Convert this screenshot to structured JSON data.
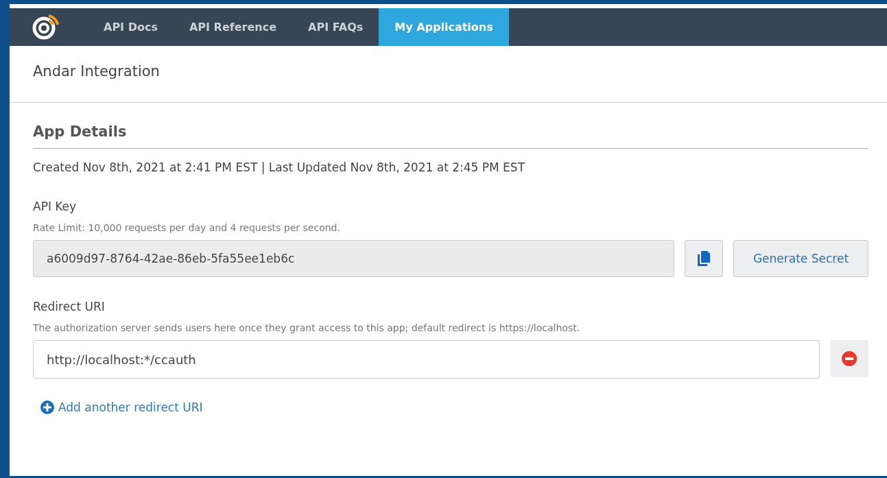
{
  "nav": {
    "tabs": [
      {
        "label": "API Docs",
        "selected": false
      },
      {
        "label": "API Reference",
        "selected": false
      },
      {
        "label": "API FAQs",
        "selected": false
      },
      {
        "label": "My Applications",
        "selected": true
      }
    ]
  },
  "page_title": "Andar Integration",
  "section": {
    "heading": "App Details",
    "timestamps": "Created Nov 8th, 2021 at 2:41 PM EST | Last Updated Nov 8th, 2021 at 2:45 PM EST",
    "api_key": {
      "label": "API Key",
      "hint": "Rate Limit: 10,000 requests per day and 4 requests per second.",
      "value": "a6009d97-8764-42ae-86eb-5fa55ee1eb6c",
      "button": "Generate Secret"
    },
    "redirect": {
      "label": "Redirect URI",
      "hint": "The authorization server sends users here once they grant access to this app; default redirect is https://localhost.",
      "uris": [
        "http://localhost:*/ccauth"
      ],
      "add_link": "Add another redirect URI"
    }
  }
}
